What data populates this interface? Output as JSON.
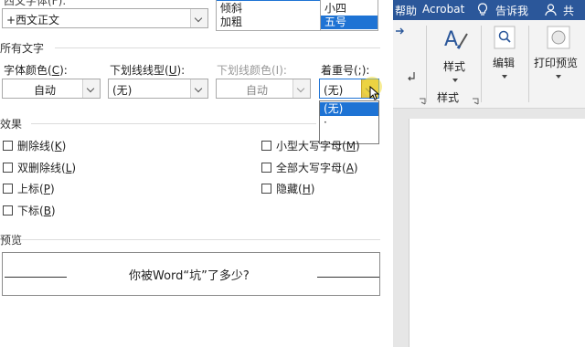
{
  "top_fields": {
    "font_value": "+西文正文",
    "style_items": [
      "倾斜",
      "加粗"
    ],
    "size_items": [
      "小四",
      "五号"
    ],
    "size_selected_index": 1
  },
  "sections": {
    "all_text": "所有文字",
    "effects": "效果",
    "preview": "预览"
  },
  "font_color": {
    "label": "字体颜色(",
    "key": "C",
    "end": "):",
    "value": "自动"
  },
  "underline_style": {
    "label": "下划线线型(",
    "key": "U",
    "end": "):",
    "value": "(无)"
  },
  "underline_color": {
    "label": "下划线颜色(I):",
    "value": "自动"
  },
  "emphasis": {
    "label": "着重号(;):",
    "value": "(无)",
    "options": [
      "(无)",
      "·"
    ]
  },
  "effects_left": [
    {
      "label": "删除线(",
      "key": "K",
      "end": ")"
    },
    {
      "label": "双删除线(",
      "key": "L",
      "end": ")"
    },
    {
      "label": "上标(",
      "key": "P",
      "end": ")"
    },
    {
      "label": "下标(",
      "key": "B",
      "end": ")"
    }
  ],
  "effects_right": [
    {
      "label": "小型大写字母(",
      "key": "M",
      "end": ")"
    },
    {
      "label": "全部大写字母(",
      "key": "A",
      "end": ")"
    },
    {
      "label": "隐藏(",
      "key": "H",
      "end": ")"
    }
  ],
  "preview_text": "你被Word“坑”了多少?",
  "ribbon": {
    "tab_help": "帮助",
    "tab_acrobat": "Acrobat",
    "tell_me": "告诉我",
    "share": "共",
    "styles_btn": "样式",
    "edit_btn": "编辑",
    "print_preview_btn": "打印预览",
    "styles_group": "样式"
  },
  "colors": {
    "accent": "#2b579a",
    "selection": "#1e73d4"
  }
}
